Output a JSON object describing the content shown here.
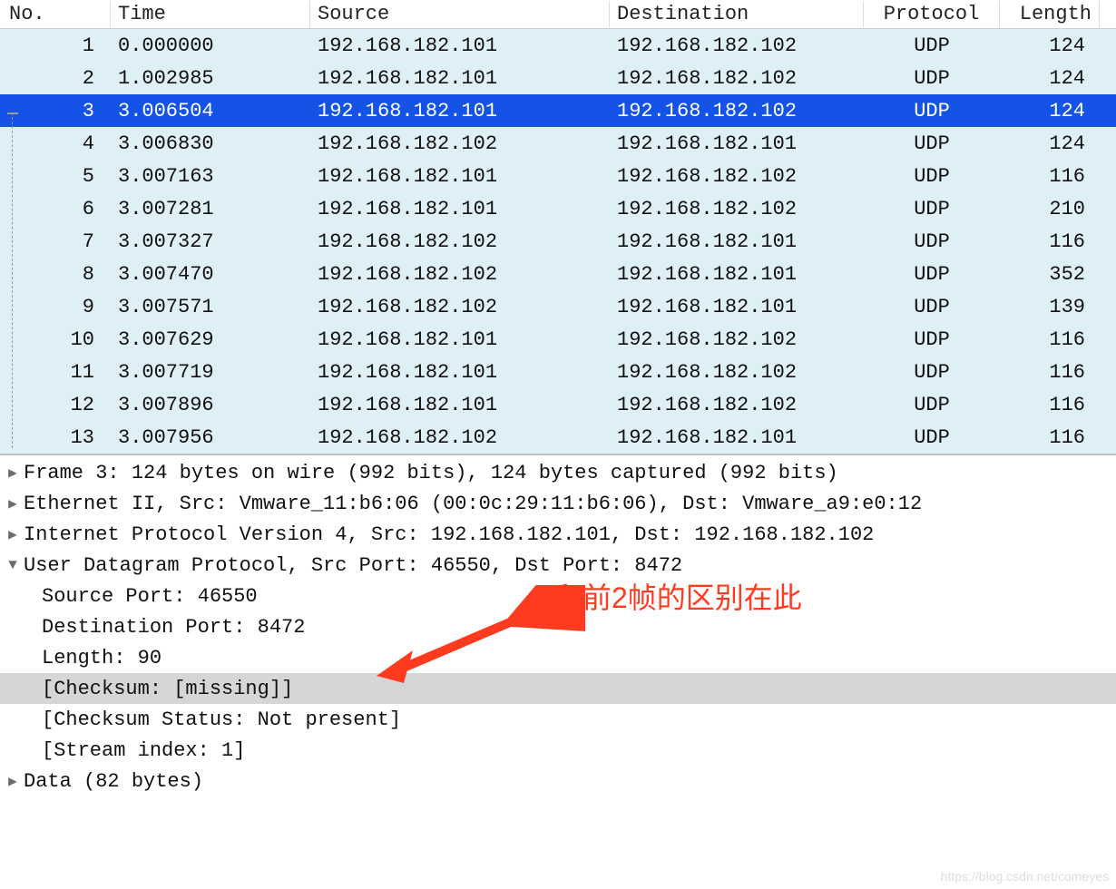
{
  "columns": {
    "no": "No.",
    "time": "Time",
    "source": "Source",
    "destination": "Destination",
    "protocol": "Protocol",
    "length": "Length"
  },
  "packets": [
    {
      "no": "1",
      "time": "0.000000",
      "source": "192.168.182.101",
      "destination": "192.168.182.102",
      "protocol": "UDP",
      "length": "124",
      "selected": false
    },
    {
      "no": "2",
      "time": "1.002985",
      "source": "192.168.182.101",
      "destination": "192.168.182.102",
      "protocol": "UDP",
      "length": "124",
      "selected": false
    },
    {
      "no": "3",
      "time": "3.006504",
      "source": "192.168.182.101",
      "destination": "192.168.182.102",
      "protocol": "UDP",
      "length": "124",
      "selected": true
    },
    {
      "no": "4",
      "time": "3.006830",
      "source": "192.168.182.102",
      "destination": "192.168.182.101",
      "protocol": "UDP",
      "length": "124",
      "selected": false
    },
    {
      "no": "5",
      "time": "3.007163",
      "source": "192.168.182.101",
      "destination": "192.168.182.102",
      "protocol": "UDP",
      "length": "116",
      "selected": false
    },
    {
      "no": "6",
      "time": "3.007281",
      "source": "192.168.182.101",
      "destination": "192.168.182.102",
      "protocol": "UDP",
      "length": "210",
      "selected": false
    },
    {
      "no": "7",
      "time": "3.007327",
      "source": "192.168.182.102",
      "destination": "192.168.182.101",
      "protocol": "UDP",
      "length": "116",
      "selected": false
    },
    {
      "no": "8",
      "time": "3.007470",
      "source": "192.168.182.102",
      "destination": "192.168.182.101",
      "protocol": "UDP",
      "length": "352",
      "selected": false
    },
    {
      "no": "9",
      "time": "3.007571",
      "source": "192.168.182.102",
      "destination": "192.168.182.101",
      "protocol": "UDP",
      "length": "139",
      "selected": false
    },
    {
      "no": "10",
      "time": "3.007629",
      "source": "192.168.182.101",
      "destination": "192.168.182.102",
      "protocol": "UDP",
      "length": "116",
      "selected": false
    },
    {
      "no": "11",
      "time": "3.007719",
      "source": "192.168.182.101",
      "destination": "192.168.182.102",
      "protocol": "UDP",
      "length": "116",
      "selected": false
    },
    {
      "no": "12",
      "time": "3.007896",
      "source": "192.168.182.101",
      "destination": "192.168.182.102",
      "protocol": "UDP",
      "length": "116",
      "selected": false
    },
    {
      "no": "13",
      "time": "3.007956",
      "source": "192.168.182.102",
      "destination": "192.168.182.101",
      "protocol": "UDP",
      "length": "116",
      "selected": false
    }
  ],
  "details": {
    "frame": "Frame 3: 124 bytes on wire (992 bits), 124 bytes captured (992 bits)",
    "ethernet": "Ethernet II, Src: Vmware_11:b6:06 (00:0c:29:11:b6:06), Dst: Vmware_a9:e0:12",
    "ip": "Internet Protocol Version 4, Src: 192.168.182.101, Dst: 192.168.182.102",
    "udp": "User Datagram Protocol, Src Port: 46550, Dst Port: 8472",
    "udp_children": {
      "src_port": "Source Port: 46550",
      "dst_port": "Destination Port: 8472",
      "length": "Length: 90",
      "checksum": "[Checksum: [missing]]",
      "chk_status": "[Checksum Status: Not present]",
      "stream": "[Stream index: 1]"
    },
    "data": "Data (82 bytes)"
  },
  "annotation": "和前2帧的区别在此",
  "watermark": "https://blog.csdn.net/comeyes",
  "colors": {
    "row_bg": "#dfeff6",
    "selected_bg": "#1453e5",
    "highlight_bg": "#d6d6d6",
    "annotation": "#ff3b1f"
  }
}
